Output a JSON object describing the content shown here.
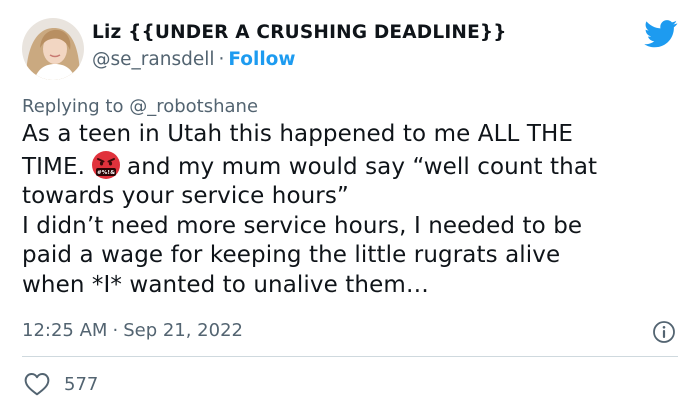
{
  "author": {
    "display_name": "Liz {{UNDER A CRUSHING DEADLINE}}",
    "handle": "@se_ransdell",
    "separator": "·",
    "follow_label": "Follow"
  },
  "reply": {
    "prefix": "Replying to",
    "mention": "@_robotshane"
  },
  "tweet": {
    "line1": "As a teen in Utah this happened to me ALL THE",
    "line2_before_emoji": "TIME.",
    "emoji": "face-with-symbols-on-mouth",
    "line2_after_emoji": "and my mum would say “well count that",
    "line3": "towards your service hours”",
    "line4": "I didn’t need more service hours, I needed to be",
    "line5": "paid a wage for keeping the little rugrats alive",
    "line6": "when *I* wanted to unalive them…"
  },
  "meta": {
    "time": "12:25 AM",
    "separator": "·",
    "date": "Sep 21, 2022"
  },
  "engagement": {
    "likes": "577"
  },
  "icons": {
    "brand": "twitter-bird-icon",
    "info": "info-icon",
    "like": "heart-icon"
  },
  "colors": {
    "accent": "#1d9bf0",
    "muted": "#536471",
    "text": "#0f1419",
    "divider": "#cfd9de",
    "emoji_red": "#e0323c"
  }
}
